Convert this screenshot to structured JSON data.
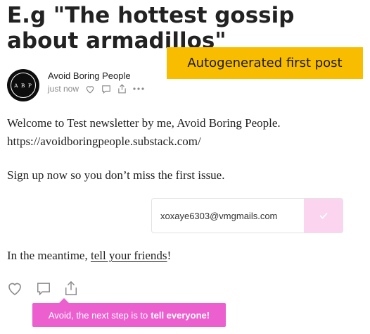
{
  "post": {
    "title": "E.g \"The hottest gossip about armadillos\"",
    "banner": "Autogenerated first post"
  },
  "author": {
    "name": "Avoid Boring People",
    "avatar_initials": "A B P",
    "timestamp": "just now",
    "meta_icons": [
      "heart-icon",
      "comment-icon",
      "share-icon",
      "more-icon"
    ]
  },
  "body": {
    "welcome": "Welcome to Test newsletter by me, Avoid Boring People.",
    "url": "https://avoidboringpeople.substack.com/",
    "signup": "Sign up now so you don’t miss the first issue.",
    "meantime_prefix": "In the meantime, ",
    "meantime_link": "tell your friends",
    "meantime_suffix": "!"
  },
  "subscribe": {
    "email_value": "xoxaye6303@vmgmails.com",
    "submit_icon": "check-icon",
    "accent_color": "#fbd4f0"
  },
  "actions": {
    "icons": [
      "heart-icon",
      "comment-icon",
      "share-icon"
    ]
  },
  "tooltip": {
    "prefix": "Avoid, the next step is to",
    "emphasis": "tell everyone!",
    "color": "#ec5fcf"
  }
}
